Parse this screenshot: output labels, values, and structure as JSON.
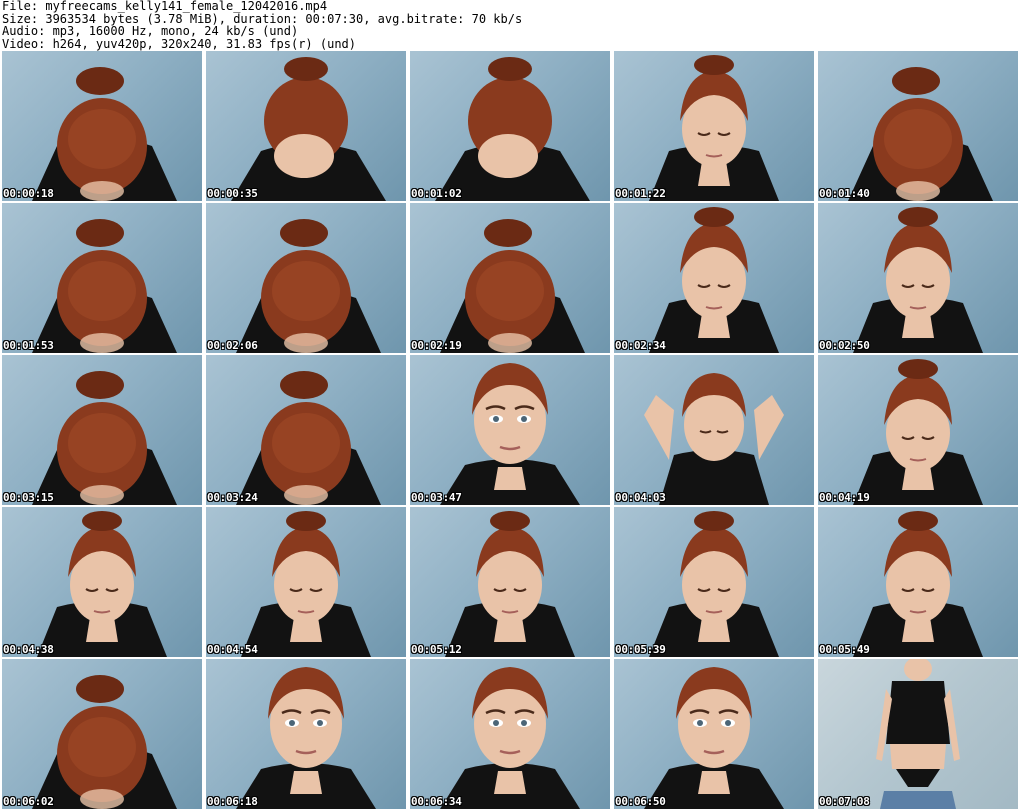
{
  "header": {
    "file_line": "File: myfreecams_kelly141_female_12042016.mp4",
    "size_line": "Size: 3963534 bytes (3.78 MiB), duration: 00:07:30, avg.bitrate: 70 kb/s",
    "audio_line": "Audio: mp3, 16000 Hz, mono, 24 kb/s (und)",
    "video_line": "Video: h264, yuv420p, 320x240, 31.83 fps(r) (und)"
  },
  "thumbnails": [
    {
      "time": "00:00:18",
      "pose": "head-down"
    },
    {
      "time": "00:00:35",
      "pose": "head-tilt"
    },
    {
      "time": "00:01:02",
      "pose": "head-tilt"
    },
    {
      "time": "00:01:22",
      "pose": "face-down"
    },
    {
      "time": "00:01:40",
      "pose": "head-down"
    },
    {
      "time": "00:01:53",
      "pose": "head-down"
    },
    {
      "time": "00:02:06",
      "pose": "head-down"
    },
    {
      "time": "00:02:19",
      "pose": "head-down"
    },
    {
      "time": "00:02:34",
      "pose": "face-down"
    },
    {
      "time": "00:02:50",
      "pose": "face-down"
    },
    {
      "time": "00:03:15",
      "pose": "head-down"
    },
    {
      "time": "00:03:24",
      "pose": "head-down"
    },
    {
      "time": "00:03:47",
      "pose": "face"
    },
    {
      "time": "00:04:03",
      "pose": "arms-up"
    },
    {
      "time": "00:04:19",
      "pose": "face-down"
    },
    {
      "time": "00:04:38",
      "pose": "face-down"
    },
    {
      "time": "00:04:54",
      "pose": "face-down"
    },
    {
      "time": "00:05:12",
      "pose": "face-down"
    },
    {
      "time": "00:05:39",
      "pose": "face-down"
    },
    {
      "time": "00:05:49",
      "pose": "face-down"
    },
    {
      "time": "00:06:02",
      "pose": "head-down"
    },
    {
      "time": "00:06:18",
      "pose": "face"
    },
    {
      "time": "00:06:34",
      "pose": "face"
    },
    {
      "time": "00:06:50",
      "pose": "face"
    },
    {
      "time": "00:07:08",
      "pose": "standing"
    }
  ],
  "colors": {
    "hair": "#8a3a1e",
    "skin": "#e9c3a8",
    "shirt": "#121212",
    "background": "#8fb0c4"
  }
}
